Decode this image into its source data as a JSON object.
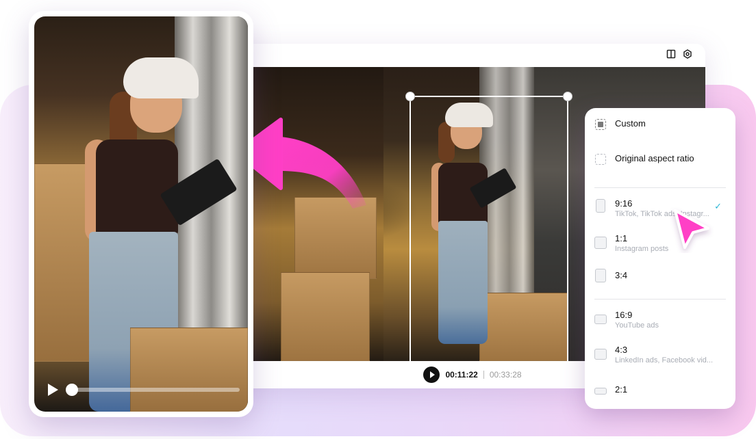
{
  "colors": {
    "accent_pink": "#ff3fc6",
    "check_teal": "#2bb6d6",
    "text_primary": "#111111",
    "text_muted": "#a9adb5"
  },
  "editor": {
    "toolbar_icons": [
      "split-view-icon",
      "gear-icon"
    ],
    "playback": {
      "current_time": "00:11:22",
      "total_time": "00:33:28"
    }
  },
  "phone_preview": {
    "progress": 0.0
  },
  "aspect_panel": {
    "items": [
      {
        "label": "Custom",
        "sub": "",
        "icon": "custom-crop-icon",
        "selected": false
      },
      {
        "label": "Original aspect ratio",
        "sub": "",
        "icon": "original-ratio-icon",
        "selected": false
      },
      {
        "label": "9:16",
        "sub": "TikTok, TikTok ads, Instagr...",
        "icon": "ratio-9-16-icon",
        "selected": true
      },
      {
        "label": "1:1",
        "sub": "Instagram posts",
        "icon": "ratio-1-1-icon",
        "selected": false
      },
      {
        "label": "3:4",
        "sub": "",
        "icon": "ratio-3-4-icon",
        "selected": false
      },
      {
        "label": "16:9",
        "sub": "YouTube ads",
        "icon": "ratio-16-9-icon",
        "selected": false
      },
      {
        "label": "4:3",
        "sub": "LinkedIn ads, Facebook vid...",
        "icon": "ratio-4-3-icon",
        "selected": false
      },
      {
        "label": "2:1",
        "sub": "",
        "icon": "ratio-2-1-icon",
        "selected": false
      }
    ],
    "check_glyph": "✓"
  }
}
